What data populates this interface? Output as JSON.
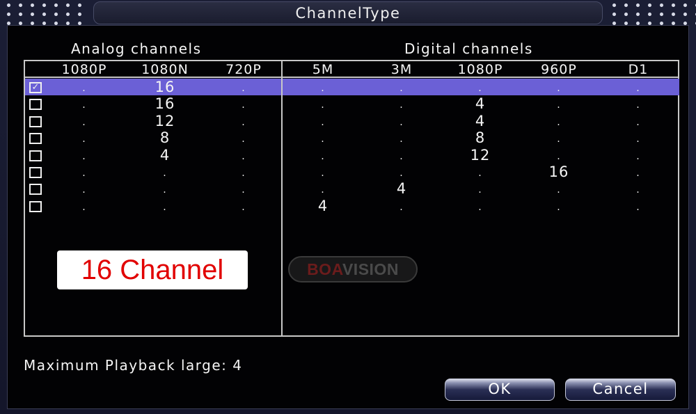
{
  "window": {
    "title": "ChannelType"
  },
  "sections": {
    "analog_title": "Analog channels",
    "digital_title": "Digital channels"
  },
  "columns": {
    "analog": [
      "1080P",
      "1080N",
      "720P"
    ],
    "digital": [
      "5M",
      "3M",
      "1080P",
      "960P",
      "D1"
    ]
  },
  "rows": [
    {
      "checked": true,
      "analog": [
        ".",
        "16",
        "."
      ],
      "digital": [
        ".",
        ".",
        ".",
        ".",
        "."
      ]
    },
    {
      "checked": false,
      "analog": [
        ".",
        "16",
        "."
      ],
      "digital": [
        ".",
        ".",
        "4",
        ".",
        "."
      ]
    },
    {
      "checked": false,
      "analog": [
        ".",
        "12",
        "."
      ],
      "digital": [
        ".",
        ".",
        "4",
        ".",
        "."
      ]
    },
    {
      "checked": false,
      "analog": [
        ".",
        "8",
        "."
      ],
      "digital": [
        ".",
        ".",
        "8",
        ".",
        "."
      ]
    },
    {
      "checked": false,
      "analog": [
        ".",
        "4",
        "."
      ],
      "digital": [
        ".",
        ".",
        "12",
        ".",
        "."
      ]
    },
    {
      "checked": false,
      "analog": [
        ".",
        ".",
        "."
      ],
      "digital": [
        ".",
        ".",
        ".",
        "16",
        "."
      ]
    },
    {
      "checked": false,
      "analog": [
        ".",
        ".",
        "."
      ],
      "digital": [
        ".",
        "4",
        ".",
        ".",
        "."
      ]
    },
    {
      "checked": false,
      "analog": [
        ".",
        ".",
        "."
      ],
      "digital": [
        "4",
        ".",
        ".",
        ".",
        "."
      ]
    }
  ],
  "selected_row": 0,
  "promo_label": "16 Channel",
  "watermark": {
    "part1": "BOA",
    "part2": "VISION"
  },
  "footer": {
    "playback_text": "Maximum Playback large: 4"
  },
  "buttons": {
    "ok": "OK",
    "cancel": "Cancel"
  },
  "colors": {
    "selection": "#6b60d6",
    "promo_text": "#e10000",
    "background": "#020204"
  }
}
